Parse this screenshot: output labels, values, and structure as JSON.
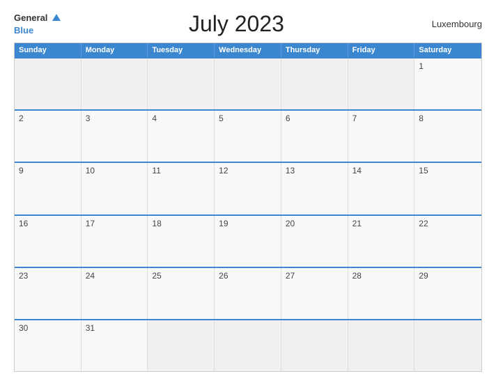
{
  "header": {
    "logo_general": "General",
    "logo_blue": "Blue",
    "title": "July 2023",
    "country": "Luxembourg"
  },
  "days_of_week": [
    "Sunday",
    "Monday",
    "Tuesday",
    "Wednesday",
    "Thursday",
    "Friday",
    "Saturday"
  ],
  "weeks": [
    [
      null,
      null,
      null,
      null,
      null,
      null,
      1
    ],
    [
      2,
      3,
      4,
      5,
      6,
      7,
      8
    ],
    [
      9,
      10,
      11,
      12,
      13,
      14,
      15
    ],
    [
      16,
      17,
      18,
      19,
      20,
      21,
      22
    ],
    [
      23,
      24,
      25,
      26,
      27,
      28,
      29
    ],
    [
      30,
      31,
      null,
      null,
      null,
      null,
      null
    ]
  ]
}
